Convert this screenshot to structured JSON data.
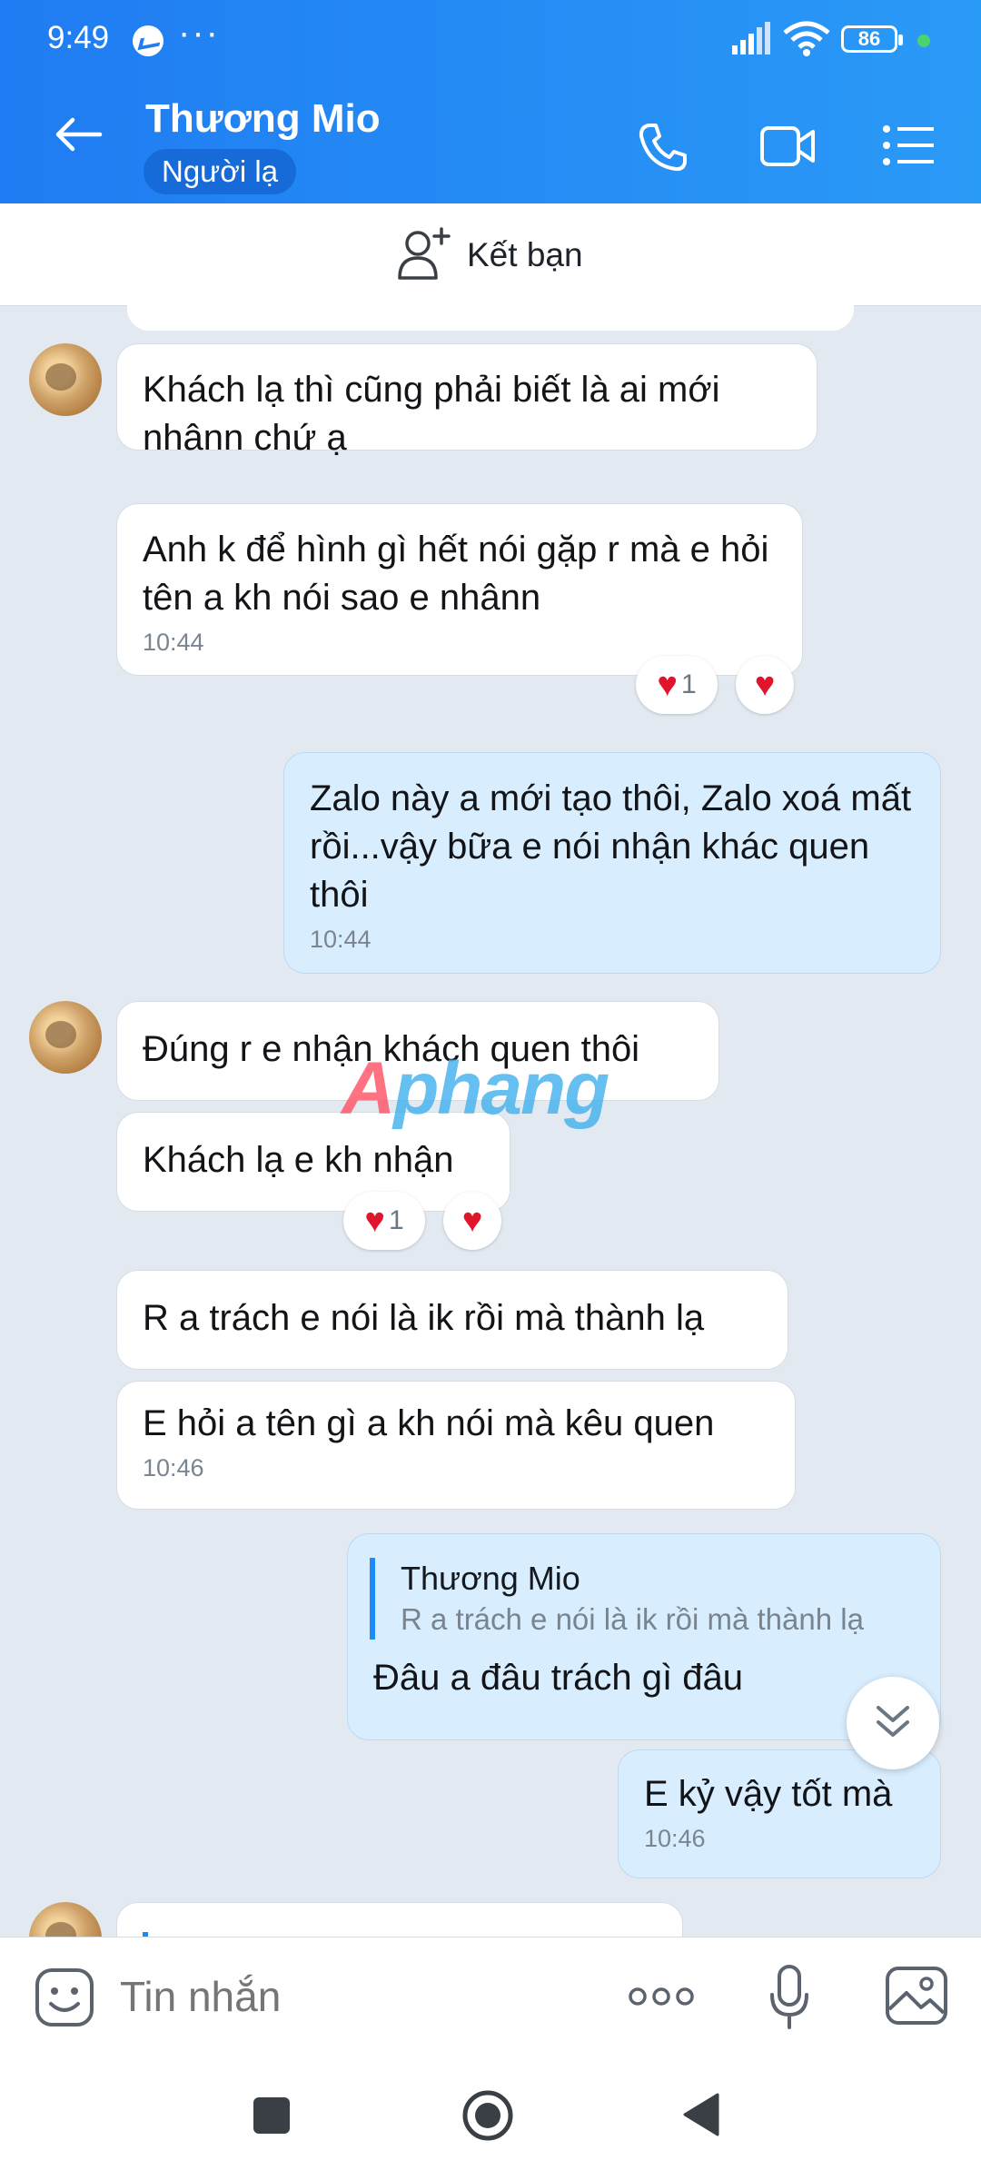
{
  "status_bar": {
    "time": "9:49",
    "battery": "86"
  },
  "header": {
    "name": "Thương Mio",
    "badge": "Người lạ"
  },
  "friend_bar": {
    "label": "Kết bạn"
  },
  "messages": [
    {
      "text": "Khách lạ thì cũng phải biết là ai mới nhânn chứ ạ"
    },
    {
      "text": "Anh k để hình gì hết nói gặp r mà e hỏi tên a kh nói sao e nhânn",
      "time": "10:44",
      "reaction_count": "1"
    },
    {
      "text": "Zalo này a mới tạo thôi, Zalo xoá mất rồi...vậy bữa e nói nhận khác quen thôi",
      "time": "10:44"
    },
    {
      "text": "Đúng r e nhận khách quen thôi"
    },
    {
      "text": "Khách lạ e kh nhận",
      "reaction_count": "1"
    },
    {
      "text": "R a trách e nói là ik rồi mà thành lạ"
    },
    {
      "text": "E hỏi a tên gì a kh nói mà kêu quen",
      "time": "10:46"
    },
    {
      "reply_name": "Thương Mio",
      "reply_text": "R a trách e nói là ik rồi mà thành lạ",
      "text": "Đâu a đâu trách gì đâu"
    },
    {
      "text": "E kỷ vậy tốt mà",
      "time": "10:46"
    }
  ],
  "watermark": {
    "a": "A",
    "rest": "phang"
  },
  "composer": {
    "placeholder": "Tin nhắn"
  },
  "icons": {
    "back": "arrow-left-icon",
    "phone": "phone-icon",
    "video": "video-icon",
    "menu": "menu-icon",
    "add_friend": "add-friend-icon",
    "emoji": "emoji-icon",
    "more": "more-icon",
    "mic": "mic-icon",
    "image": "image-icon",
    "scroll": "double-chevron-down-icon"
  },
  "colors": {
    "header": "#1f7cf2",
    "out_bubble": "#d8eeff",
    "reaction": "#e0142b"
  }
}
